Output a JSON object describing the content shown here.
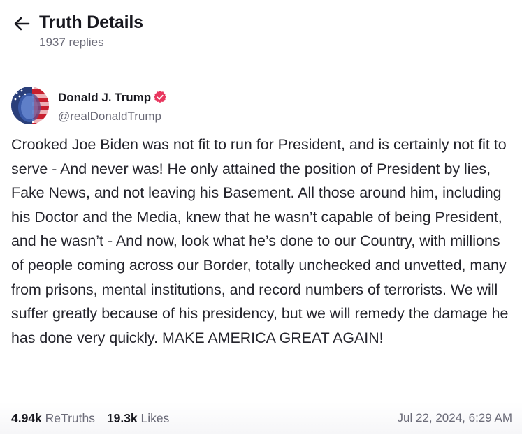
{
  "header": {
    "title": "Truth Details",
    "replies": "1937 replies",
    "back_icon": "arrow-left-icon"
  },
  "post": {
    "author": {
      "name": "Donald J. Trump",
      "handle": "@realDonaldTrump",
      "verified": true,
      "verified_color": "#e8365e"
    },
    "text": "Crooked Joe Biden was not fit to run for President, and is certainly not fit to serve - And never was! He only attained the position of President by lies, Fake News, and not leaving his Basement. All those around him, including his Doctor and the Media, knew that he wasn’t capable of being President, and he wasn’t - And now, look what he’s done to our Country, with millions of people coming across our Border, totally unchecked and unvetted, many from prisons, mental institutions, and record numbers of terrorists. We will suffer greatly because of his presidency, but we will remedy the damage he has done very quickly. MAKE AMERICA GREAT AGAIN!",
    "retruths_count": "4.94k",
    "retruths_label": "ReTruths",
    "likes_count": "19.3k",
    "likes_label": "Likes",
    "timestamp": "Jul 22, 2024, 6:29 AM"
  },
  "colors": {
    "text_primary": "#18181f",
    "text_secondary": "#6b6b78"
  }
}
